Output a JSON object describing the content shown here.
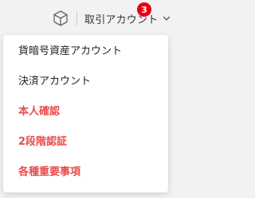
{
  "header": {
    "icon": "cube-icon",
    "account_menu_label": "取引アカウント",
    "notification_count": "3",
    "badge_color": "#e60012"
  },
  "dropdown": {
    "items": [
      {
        "label": "貨暗号資産アカウント",
        "style": "normal"
      },
      {
        "label": "決済アカウント",
        "style": "normal"
      },
      {
        "label": "本人確認",
        "style": "alert"
      },
      {
        "label": "2段階認証",
        "style": "alert"
      },
      {
        "label": "各種重要事項",
        "style": "alert"
      }
    ],
    "alert_color": "#e84c4c"
  }
}
